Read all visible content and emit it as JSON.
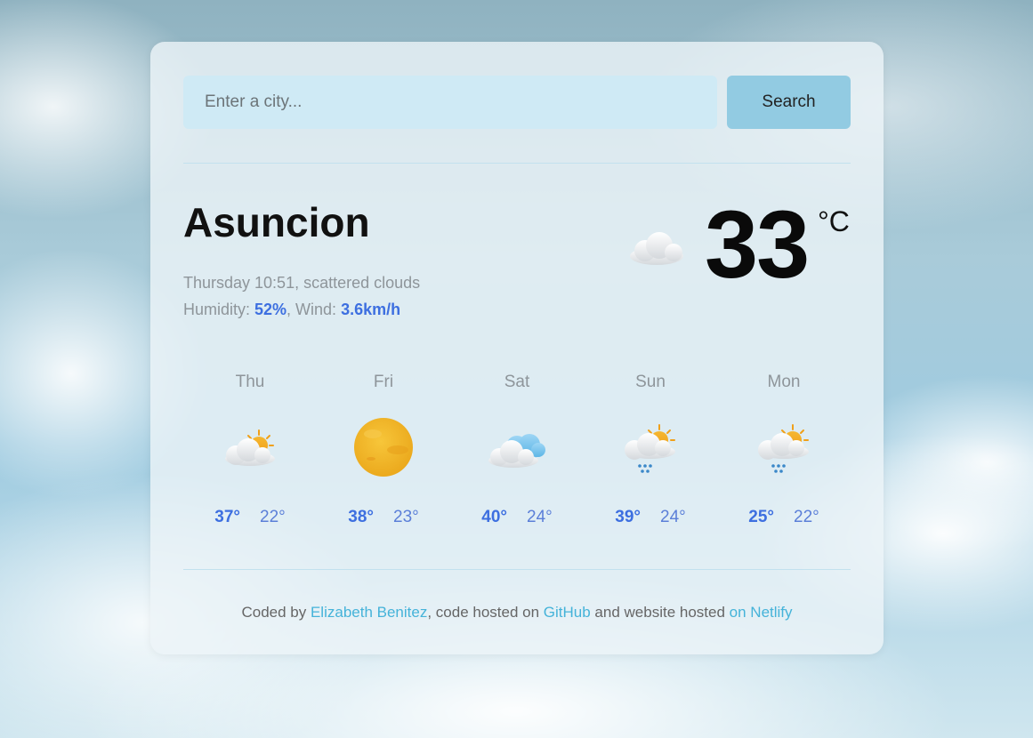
{
  "search": {
    "placeholder": "Enter a city...",
    "value": "",
    "button_label": "Search"
  },
  "current": {
    "city": "Asuncion",
    "description": "Thursday 10:51, scattered clouds",
    "humidity_label": "Humidity: ",
    "humidity_value": "52%",
    "wind_label": ", Wind: ",
    "wind_value": "3.6km/h",
    "temperature": "33",
    "unit": "°C",
    "icon": "cloud-icon"
  },
  "forecast": [
    {
      "day": "Thu",
      "max": "37°",
      "min": "22°",
      "icon": "partly-sunny-icon"
    },
    {
      "day": "Fri",
      "max": "38°",
      "min": "23°",
      "icon": "sun-icon"
    },
    {
      "day": "Sat",
      "max": "40°",
      "min": "24°",
      "icon": "cloudy-icon"
    },
    {
      "day": "Sun",
      "max": "39°",
      "min": "24°",
      "icon": "sun-rain-icon"
    },
    {
      "day": "Mon",
      "max": "25°",
      "min": "22°",
      "icon": "sun-rain-icon"
    }
  ],
  "footer": {
    "prefix": "Coded by ",
    "author_link": "Elizabeth Benitez",
    "middle": ", code hosted on ",
    "github_link": "GitHub",
    "middle2": " and website hosted ",
    "netlify_link": "on Netlify"
  },
  "colors": {
    "accent": "#3d6fe0",
    "link": "#45b3d9",
    "button": "#92cbe2",
    "input_bg": "#cfeaf5"
  }
}
